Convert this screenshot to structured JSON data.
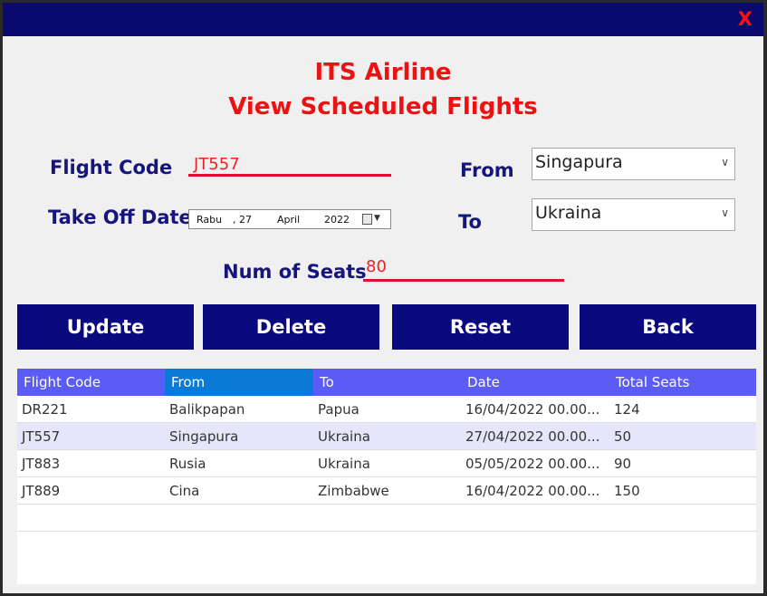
{
  "window": {
    "close_label": "X"
  },
  "header": {
    "title": "ITS Airline",
    "subtitle": "View Scheduled Flights"
  },
  "form": {
    "flight_code_label": "Flight Code",
    "flight_code_value": "JT557",
    "take_off_date_label": "Take Off Date",
    "date": {
      "day_name": "Rabu",
      "day": ", 27",
      "month": "April",
      "year": "2022"
    },
    "from_label": "From",
    "from_value": "Singapura",
    "to_label": "To",
    "to_value": "Ukraina",
    "seats_label": "Num of Seats",
    "seats_value": "80"
  },
  "buttons": {
    "update": "Update",
    "delete": "Delete",
    "reset": "Reset",
    "back": "Back"
  },
  "table": {
    "columns": [
      "Flight Code",
      "From",
      "To",
      "Date",
      "Total Seats"
    ],
    "rows": [
      [
        "DR221",
        "Balikpapan",
        "Papua",
        "16/04/2022 00.00...",
        "124"
      ],
      [
        "JT557",
        "Singapura",
        "Ukraina",
        "27/04/2022 00.00...",
        "50"
      ],
      [
        "JT883",
        "Rusia",
        "Ukraina",
        "05/05/2022 00.00...",
        "90"
      ],
      [
        "JT889",
        "Cina",
        "Zimbabwe",
        "16/04/2022 00.00...",
        "150"
      ]
    ]
  },
  "colors": {
    "title_bar": "#0a0a6e",
    "heading": "#ee1111",
    "label": "#15157a",
    "button": "#0a0a7e",
    "table_header": "#5b5bf5",
    "table_header_selected": "#0a7ad6",
    "selected_row": "#e6e6fb"
  }
}
